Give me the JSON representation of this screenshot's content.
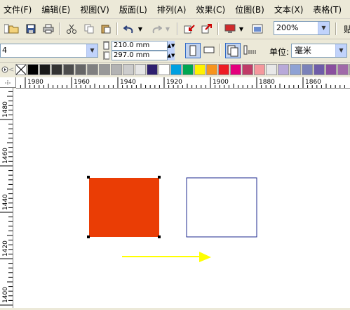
{
  "menu": {
    "items": [
      "文件(F)",
      "编辑(E)",
      "视图(V)",
      "版面(L)",
      "排列(A)",
      "效果(C)",
      "位图(B)",
      "文本(X)",
      "表格(T)"
    ]
  },
  "toolbar": {
    "icons": [
      "new-icon",
      "open-icon",
      "save-icon",
      "print-icon",
      "cut-icon",
      "copy-icon",
      "paste-icon",
      "undo-icon",
      "redo-icon",
      "import-icon",
      "export-icon",
      "application-launcher-icon",
      "welcome-screen-icon"
    ],
    "zoom_value": "200%",
    "tail_text": "贴"
  },
  "property_bar": {
    "preset_value": "4",
    "width_value": "210.0 mm",
    "height_value": "297.0 mm",
    "unit_label": "单位:",
    "unit_value": "毫米"
  },
  "palette": {
    "colors": [
      "#000000",
      "#1a1a1a",
      "#333333",
      "#4d4d4d",
      "#666666",
      "#808080",
      "#999999",
      "#b3b3b3",
      "#cccccc",
      "#e6e6e6",
      "#2e1f6e",
      "#ffffff",
      "#00a0e0",
      "#00a651",
      "#fff200",
      "#f7941d",
      "#ed1c24",
      "#e4007c",
      "#c03c67",
      "#f5989d",
      "#e8e8e8",
      "#b8a9d9",
      "#8fa2d4",
      "#7b82b9",
      "#6e5ca8",
      "#8a4f9e",
      "#a06aa8",
      "#c9a0c8"
    ]
  },
  "rulers": {
    "horizontal": [
      "1980",
      "1960",
      "1940",
      "1920",
      "1900",
      "1880",
      "1860"
    ],
    "vertical": [
      "1480",
      "1460",
      "1440",
      "1420",
      "1400"
    ]
  },
  "canvas": {
    "filled_rect_color": "#ea3d05",
    "outline_rect_color": "#1c2a8f",
    "arrow_color": "#ffff00"
  }
}
